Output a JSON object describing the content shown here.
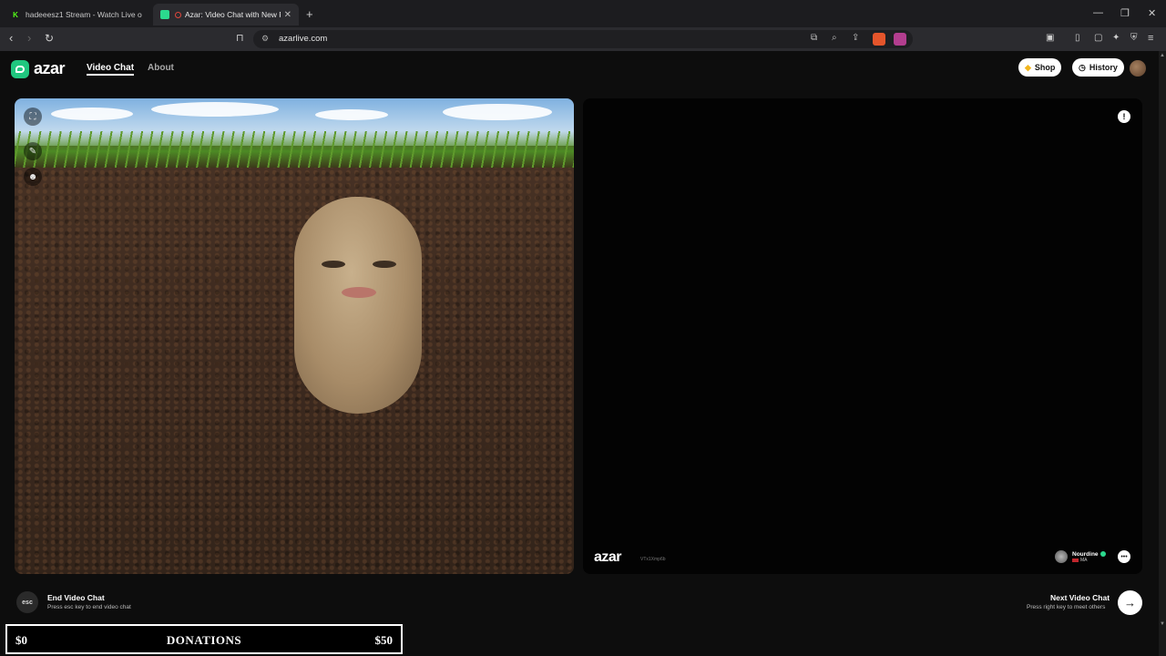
{
  "browser": {
    "tabs": [
      {
        "title": "hadeeesz1 Stream - Watch Live on Ki",
        "active": false,
        "favicon": "kick-icon"
      },
      {
        "title": "Azar: Video Chat with New Pe",
        "active": true,
        "favicon": "azar-icon"
      }
    ],
    "url": "azarlive.com",
    "extension_badge": "1"
  },
  "site": {
    "logo_text": "azar",
    "nav": [
      {
        "label": "Video Chat",
        "active": true
      },
      {
        "label": "About",
        "active": false
      }
    ],
    "shop_label": "Shop",
    "history_label": "History"
  },
  "remote_video": {
    "watermark": "azar",
    "watermark_id": "VTx1Xmp6b",
    "peer_name": "Nourdine",
    "peer_country": "MA"
  },
  "controls": {
    "esc_key": "esc",
    "end_title": "End Video Chat",
    "end_sub": "Press esc key to end video chat",
    "next_title": "Next Video Chat",
    "next_sub": "Press right key to meet others"
  },
  "donations": {
    "min": "$0",
    "label": "DONATIONS",
    "max": "$50"
  },
  "colors": {
    "brand": "#20c77f",
    "background": "#0d0d0d"
  }
}
